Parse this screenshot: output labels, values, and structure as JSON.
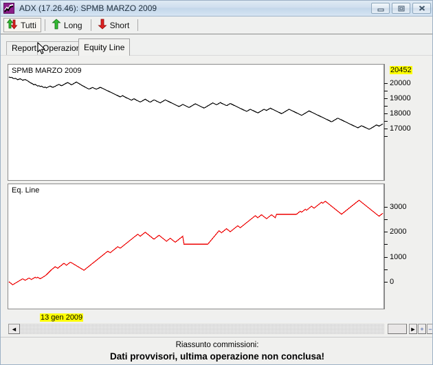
{
  "window": {
    "title": "ADX (17.26.46): SPMB MARZO 2009",
    "icon": "chart-line-icon",
    "buttons": {
      "minimize": "minimize-icon",
      "restore": "restore-icon",
      "close": "close-icon"
    }
  },
  "toolbar": {
    "items": [
      {
        "label": "Tutti",
        "icon": "up-down-arrows-icon",
        "pressed": true
      },
      {
        "label": "Long",
        "icon": "green-up-arrow-icon",
        "pressed": false
      },
      {
        "label": "Short",
        "icon": "red-down-arrow-icon",
        "pressed": false
      }
    ]
  },
  "tabs": [
    {
      "label": "Report",
      "active": false
    },
    {
      "label": "Operazioni",
      "active": false
    },
    {
      "label": "Equity Line",
      "active": true
    }
  ],
  "panels": {
    "price_label": "SPMB MARZO 2009",
    "equity_label": "Eq. Line"
  },
  "axes": {
    "price": {
      "highlight_value": "20452",
      "major_labels": [
        "20000",
        "19000",
        "18000",
        "17000"
      ]
    },
    "equity": {
      "major_labels": [
        "3000",
        "2000",
        "1000",
        "0"
      ]
    }
  },
  "date_label": "13 gen 2009",
  "scrollbar": {
    "left_arrow": "◄",
    "right_arrow": "►",
    "zoom_in": "+",
    "zoom_out": "−"
  },
  "status": {
    "line1": "Riassunto commissioni:",
    "line2": "Dati provvisori, ultima operazione non conclusa!"
  },
  "colors": {
    "price_series": "#000000",
    "equity_series": "#ee0000",
    "highlight": "#ffff00",
    "titlebar": "#cfdeee"
  },
  "chart_data": [
    {
      "type": "line",
      "title": "SPMB MARZO 2009",
      "xlabel": "",
      "ylabel": "",
      "ylim": [
        16500,
        20600
      ],
      "grid": false,
      "legend": "none",
      "color": "#000000",
      "yticks_major": [
        20000,
        19000,
        18000,
        17000
      ],
      "yticks_minor": [
        19500,
        18500,
        17500,
        16500
      ],
      "annotation_last_value": 20452,
      "x_start_label": "13 gen 2009",
      "values": [
        20430,
        20380,
        20400,
        20350,
        20300,
        20330,
        20290,
        20240,
        20270,
        20300,
        20260,
        20200,
        20230,
        20250,
        20210,
        20160,
        20100,
        20050,
        20000,
        19960,
        19900,
        19930,
        19870,
        19820,
        19840,
        19790,
        19810,
        19760,
        19720,
        19750,
        19700,
        19740,
        19780,
        19820,
        19770,
        19730,
        19760,
        19800,
        19850,
        19890,
        19930,
        19880,
        19840,
        19870,
        19920,
        19970,
        20010,
        20050,
        20000,
        19950,
        19900,
        19940,
        19990,
        20040,
        20080,
        20030,
        19980,
        19930,
        19880,
        19830,
        19790,
        19740,
        19700,
        19660,
        19620,
        19650,
        19690,
        19720,
        19680,
        19640,
        19610,
        19650,
        19690,
        19730,
        19700,
        19660,
        19620,
        19580,
        19540,
        19500,
        19460,
        19420,
        19380,
        19340,
        19300,
        19260,
        19220,
        19180,
        19140,
        19100,
        19140,
        19180,
        19130,
        19080,
        19040,
        19000,
        18960,
        18920,
        18880,
        18930,
        18980,
        18930,
        18880,
        18840,
        18800,
        18760,
        18800,
        18850,
        18900,
        18950,
        18890,
        18840,
        18790,
        18750,
        18800,
        18850,
        18900,
        18870,
        18820,
        18780,
        18740,
        18700,
        18750,
        18800,
        18850,
        18900,
        18860,
        18820,
        18780,
        18740,
        18700,
        18660,
        18620,
        18580,
        18540,
        18500,
        18460,
        18500,
        18550,
        18600,
        18560,
        18520,
        18480,
        18440,
        18400,
        18440,
        18490,
        18540,
        18590,
        18640,
        18600,
        18560,
        18520,
        18480,
        18440,
        18400,
        18360,
        18400,
        18450,
        18500,
        18550,
        18600,
        18650,
        18700,
        18660,
        18620,
        18580,
        18620,
        18670,
        18720,
        18680,
        18640,
        18600,
        18560,
        18520,
        18560,
        18610,
        18660,
        18620,
        18580,
        18540,
        18500,
        18460,
        18420,
        18380,
        18340,
        18300,
        18260,
        18220,
        18180,
        18140,
        18180,
        18230,
        18280,
        18240,
        18200,
        18160,
        18120,
        18080,
        18040,
        18080,
        18130,
        18180,
        18230,
        18280,
        18240,
        18200,
        18250,
        18300,
        18350,
        18310,
        18270,
        18230,
        18190,
        18150,
        18110,
        18070,
        18030,
        17990,
        18030,
        18080,
        18130,
        18180,
        18230,
        18280,
        18240,
        18200,
        18160,
        18120,
        18080,
        18040,
        18000,
        17960,
        17920,
        17880,
        17920,
        17970,
        18020,
        18070,
        18120,
        18170,
        18130,
        18090,
        18050,
        18010,
        17970,
        17930,
        17890,
        17850,
        17810,
        17770,
        17730,
        17690,
        17650,
        17610,
        17570,
        17530,
        17490,
        17450,
        17490,
        17540,
        17590,
        17640,
        17690,
        17650,
        17610,
        17570,
        17530,
        17490,
        17450,
        17410,
        17370,
        17330,
        17290,
        17250,
        17210,
        17170,
        17130,
        17090,
        17050,
        17090,
        17140,
        17190,
        17150,
        17110,
        17070,
        17030,
        16990,
        16950,
        16990,
        17040,
        17090,
        17140,
        17190,
        17240,
        17200,
        17160,
        17210,
        17260,
        17310
      ]
    },
    {
      "type": "line",
      "title": "Eq. Line",
      "xlabel": "",
      "ylabel": "",
      "ylim": [
        -250,
        3350
      ],
      "grid": false,
      "legend": "none",
      "color": "#ee0000",
      "yticks_major": [
        3000,
        2000,
        1000,
        0
      ],
      "yticks_minor": [
        2500,
        1500,
        500
      ],
      "values": [
        0,
        -40,
        -80,
        -120,
        -90,
        -60,
        -30,
        0,
        30,
        60,
        90,
        120,
        90,
        60,
        90,
        120,
        150,
        120,
        90,
        120,
        150,
        180,
        150,
        180,
        150,
        120,
        150,
        180,
        210,
        240,
        280,
        330,
        380,
        430,
        480,
        520,
        560,
        600,
        570,
        540,
        580,
        620,
        660,
        700,
        740,
        700,
        660,
        700,
        740,
        780,
        760,
        730,
        700,
        670,
        640,
        610,
        580,
        550,
        520,
        490,
        460,
        500,
        540,
        580,
        620,
        660,
        700,
        740,
        780,
        820,
        860,
        900,
        940,
        980,
        1020,
        1060,
        1100,
        1140,
        1180,
        1220,
        1190,
        1160,
        1200,
        1240,
        1280,
        1320,
        1360,
        1400,
        1370,
        1340,
        1380,
        1420,
        1460,
        1500,
        1540,
        1580,
        1620,
        1660,
        1700,
        1740,
        1780,
        1820,
        1860,
        1900,
        1860,
        1820,
        1860,
        1900,
        1940,
        1980,
        1940,
        1900,
        1860,
        1820,
        1780,
        1740,
        1700,
        1740,
        1780,
        1820,
        1860,
        1820,
        1780,
        1740,
        1700,
        1660,
        1620,
        1660,
        1700,
        1740,
        1700,
        1660,
        1620,
        1580,
        1620,
        1660,
        1700,
        1740,
        1780,
        1820,
        1500,
        1500,
        1500,
        1500,
        1500,
        1500,
        1500,
        1500,
        1500,
        1500,
        1500,
        1500,
        1500,
        1500,
        1500,
        1500,
        1500,
        1500,
        1500,
        1500,
        1560,
        1620,
        1680,
        1740,
        1800,
        1860,
        1920,
        1980,
        2040,
        2000,
        1960,
        2000,
        2040,
        2080,
        2120,
        2080,
        2040,
        2000,
        2040,
        2080,
        2120,
        2160,
        2200,
        2240,
        2200,
        2160,
        2200,
        2240,
        2280,
        2320,
        2360,
        2400,
        2440,
        2480,
        2520,
        2560,
        2600,
        2640,
        2600,
        2560,
        2600,
        2640,
        2680,
        2640,
        2600,
        2560,
        2520,
        2560,
        2600,
        2640,
        2680,
        2640,
        2600,
        2560,
        2700,
        2700,
        2700,
        2700,
        2700,
        2700,
        2700,
        2700,
        2700,
        2700,
        2700,
        2700,
        2700,
        2700,
        2700,
        2700,
        2700,
        2740,
        2780,
        2820,
        2780,
        2820,
        2860,
        2900,
        2860,
        2900,
        2940,
        2980,
        3020,
        2980,
        2940,
        2980,
        3020,
        3060,
        3100,
        3140,
        3180,
        3140,
        3180,
        3220,
        3180,
        3140,
        3100,
        3060,
        3020,
        2980,
        2940,
        2900,
        2860,
        2820,
        2780,
        2740,
        2700,
        2740,
        2780,
        2820,
        2860,
        2900,
        2940,
        2980,
        3020,
        3060,
        3100,
        3140,
        3180,
        3220,
        3260,
        3220,
        3180,
        3140,
        3100,
        3060,
        3020,
        2980,
        2940,
        2900,
        2860,
        2820,
        2780,
        2740,
        2700,
        2660,
        2620,
        2660,
        2700,
        2740
      ]
    }
  ]
}
